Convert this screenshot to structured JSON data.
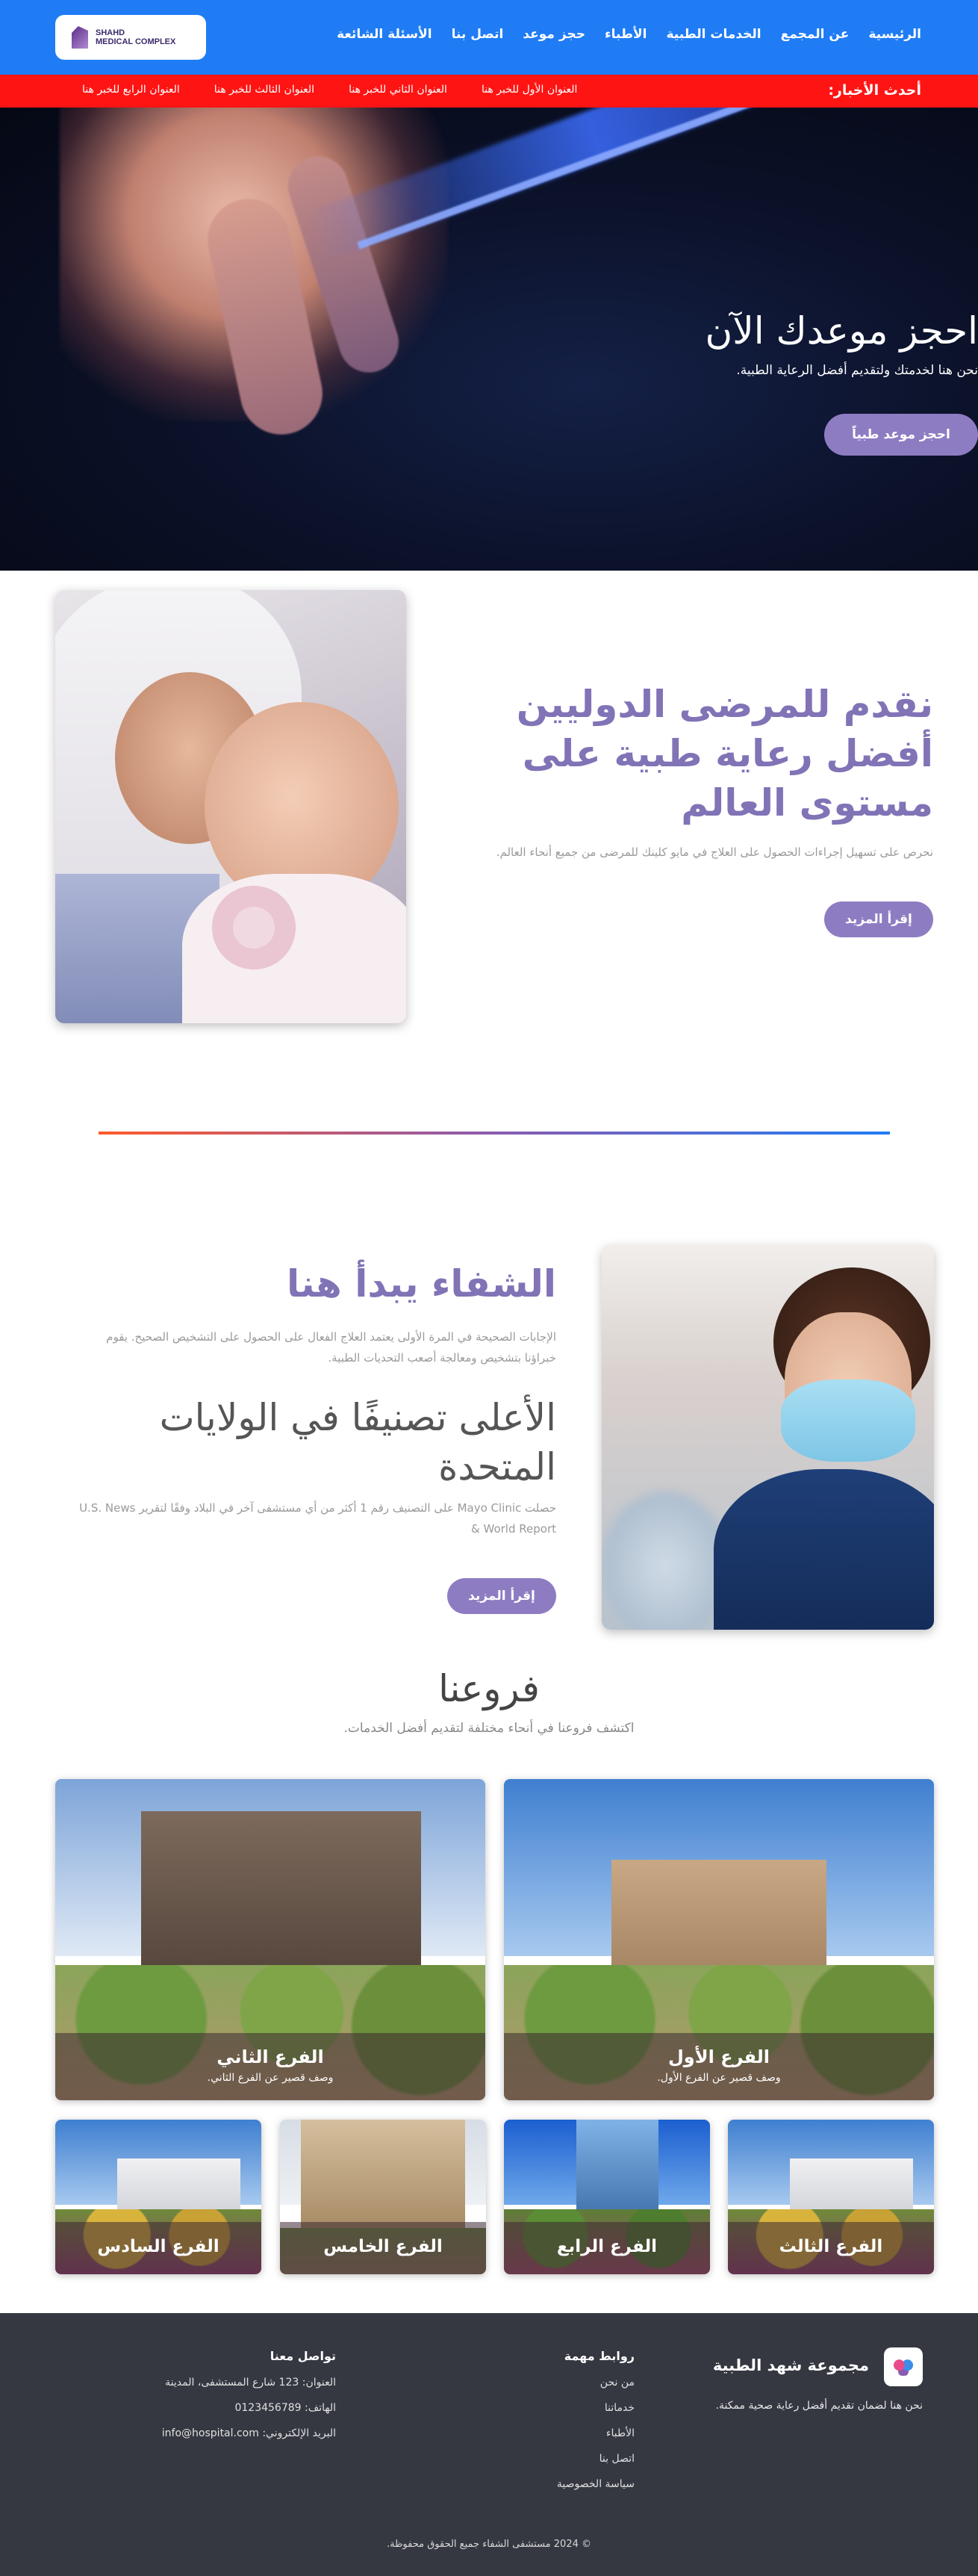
{
  "header": {
    "logo_text": "SHAHD\nMEDICAL COMPLEX",
    "nav": [
      "الرئيسية",
      "عن المجمع",
      "الخدمات الطبية",
      "الأطباء",
      "حجز موعد",
      "اتصل بنا",
      "الأسئلة الشائعة"
    ]
  },
  "ticker": {
    "title": "أحدث الأخبار:",
    "items": [
      "العنوان الأول للخبر هنا",
      "العنوان الثاني للخبر هنا",
      "العنوان الثالث للخبر هنا",
      "العنوان الرابع للخبر هنا"
    ]
  },
  "hero": {
    "title": "احجز موعدك الآن",
    "subtitle": "نحن هنا لخدمتك ولتقديم أفضل الرعاية الطبية.",
    "button": "احجز موعد طبياً"
  },
  "intro": {
    "title": "نقدم للمرضى الدوليين أفضل رعاية طبية على مستوى العالم",
    "text": "نحرص على تسهيل إجراءات الحصول على العلاج في مايو كلينك للمرضى من جميع أنحاء العالم.",
    "button": "إقرأ المزيد"
  },
  "healing": {
    "title": "الشفاء يبدأ هنا",
    "paragraph1": "الإجابات الصحيحة في المرة الأولى يعتمد العلاج الفعال على الحصول على التشخيص الصحيح. يقوم خبراؤنا بتشخيص ومعالجة أصعب التحديات الطبية.",
    "heading2": "الأعلى تصنيفًا في الولايات المتحدة",
    "paragraph2": "حصلت Mayo Clinic على التصنيف رقم 1 أكثر من أي مستشفى آخر في البلاد وفقًا لتقرير U.S. News & World Report",
    "button": "إقرأ المزيد"
  },
  "branches": {
    "title": "فروعنا",
    "subtitle": "اكتشف فروعنا في أنحاء مختلفة لتقديم أفضل الخدمات.",
    "large": [
      {
        "name": "الفرع الأول",
        "desc": "وصف قصير عن الفرع الأول."
      },
      {
        "name": "الفرع الثاني",
        "desc": "وصف قصير عن الفرع الثاني."
      }
    ],
    "small": [
      "الفرع الثالث",
      "الفرع الرابع",
      "الفرع الخامس",
      "الفرع السادس"
    ]
  },
  "footer": {
    "brand": "مجموعة شهد الطبية",
    "tagline": "نحن هنا لضمان تقديم أفضل رعاية صحية ممكنة.",
    "links_title": "روابط مهمة",
    "links": [
      "من نحن",
      "خدماتنا",
      "الأطباء",
      "اتصل بنا",
      "سياسة الخصوصية"
    ],
    "contact_title": "تواصل معنا",
    "address": "العنوان: 123 شارع المستشفى، المدينة",
    "phone": "الهاتف: 0123456789",
    "email": "البريد الإلكتروني: info@hospital.com",
    "copyright": "© 2024 مستشفى الشفاء جميع الحقوق محفوظة."
  },
  "colors": {
    "nav": "#1f7cf5",
    "ticker": "#ff1414",
    "accent": "#8e7cc3",
    "footer": "#353841"
  }
}
